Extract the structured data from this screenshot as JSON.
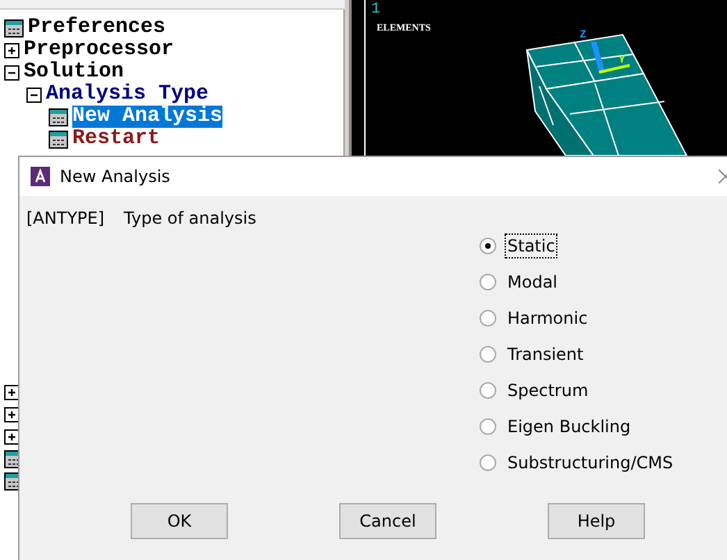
{
  "main_menu": {
    "items": [
      {
        "kind": "command",
        "label": "Preferences",
        "color": "#000000",
        "selected": false
      },
      {
        "kind": "folder",
        "label": "Preprocessor",
        "expanded": false,
        "color": "#000000",
        "selected": false
      },
      {
        "kind": "folder",
        "label": "Solution",
        "expanded": true,
        "color": "#000000",
        "selected": false,
        "children": [
          {
            "kind": "folder",
            "label": "Analysis Type",
            "expanded": true,
            "color": "#000080",
            "selected": false,
            "children": [
              {
                "kind": "command",
                "label": "New Analysis",
                "selected": true
              },
              {
                "kind": "command",
                "label": "Restart",
                "color": "#8b1a1a",
                "selected": false
              }
            ]
          }
        ]
      }
    ],
    "covered_rows": [
      {
        "kind": "folder",
        "expanded": false
      },
      {
        "kind": "folder",
        "expanded": false
      },
      {
        "kind": "folder",
        "expanded": false
      },
      {
        "kind": "command"
      },
      {
        "kind": "command"
      }
    ]
  },
  "graphics": {
    "window_number": "1",
    "plot_label": "ELEMENTS",
    "triad_labels": [
      "Z",
      "Y"
    ]
  },
  "dialog": {
    "title": "New Analysis",
    "command": "[ANTYPE]",
    "prompt": "Type of analysis",
    "options": [
      {
        "label": "Static",
        "selected": true
      },
      {
        "label": "Modal",
        "selected": false
      },
      {
        "label": "Harmonic",
        "selected": false
      },
      {
        "label": "Transient",
        "selected": false
      },
      {
        "label": "Spectrum",
        "selected": false
      },
      {
        "label": "Eigen Buckling",
        "selected": false
      },
      {
        "label": "Substructuring/CMS",
        "selected": false
      }
    ],
    "buttons": [
      "OK",
      "Cancel",
      "Help"
    ]
  }
}
